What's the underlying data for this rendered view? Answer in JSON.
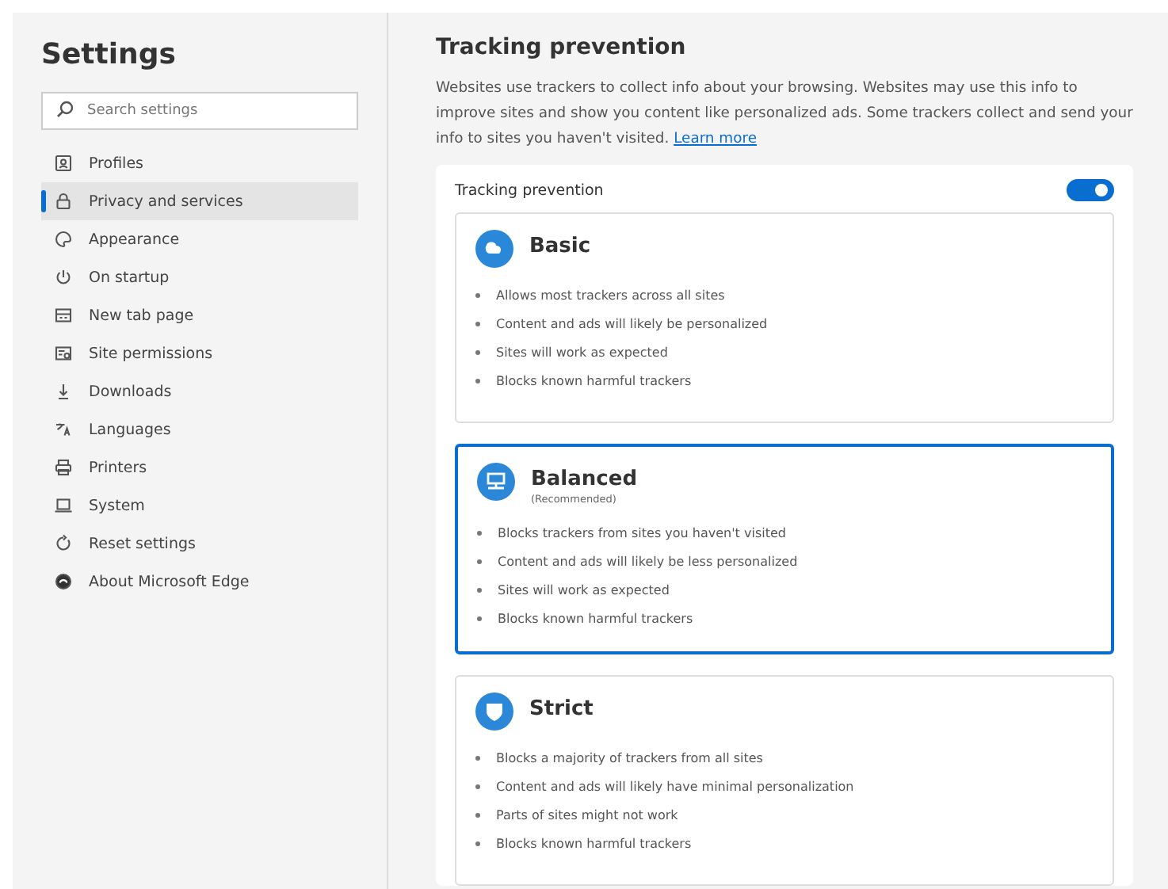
{
  "sidebar": {
    "title": "Settings",
    "search": {
      "placeholder": "Search settings"
    },
    "items": [
      {
        "label": "Profiles",
        "selected": false
      },
      {
        "label": "Privacy and services",
        "selected": true
      },
      {
        "label": "Appearance",
        "selected": false
      },
      {
        "label": "On startup",
        "selected": false
      },
      {
        "label": "New tab page",
        "selected": false
      },
      {
        "label": "Site permissions",
        "selected": false
      },
      {
        "label": "Downloads",
        "selected": false
      },
      {
        "label": "Languages",
        "selected": false
      },
      {
        "label": "Printers",
        "selected": false
      },
      {
        "label": "System",
        "selected": false
      },
      {
        "label": "Reset settings",
        "selected": false
      },
      {
        "label": "About Microsoft Edge",
        "selected": false
      }
    ]
  },
  "main": {
    "title": "Tracking prevention",
    "description": "Websites use trackers to collect info about your browsing. Websites may use this info to improve sites and show you content like personalized ads. Some trackers collect and send your info to sites you haven't visited.",
    "link": "Learn more",
    "card": {
      "label": "Tracking prevention",
      "on": true,
      "options": [
        {
          "name": "Basic",
          "selected": false,
          "points": [
            "Allows most trackers across all sites",
            "Content and ads will likely be personalized",
            "Sites will work as expected",
            "Blocks known harmful trackers"
          ]
        },
        {
          "name": "Balanced",
          "subtitle": "(Recommended)",
          "selected": true,
          "points": [
            "Blocks trackers from sites you haven't visited",
            "Content and ads will likely be less personalized",
            "Sites will work as expected",
            "Blocks known harmful trackers"
          ]
        },
        {
          "name": "Strict",
          "selected": false,
          "points": [
            "Blocks a majority of trackers from all sites",
            "Content and ads will likely have minimal personalization",
            "Parts of sites might not work",
            "Blocks known harmful trackers"
          ]
        }
      ]
    }
  }
}
